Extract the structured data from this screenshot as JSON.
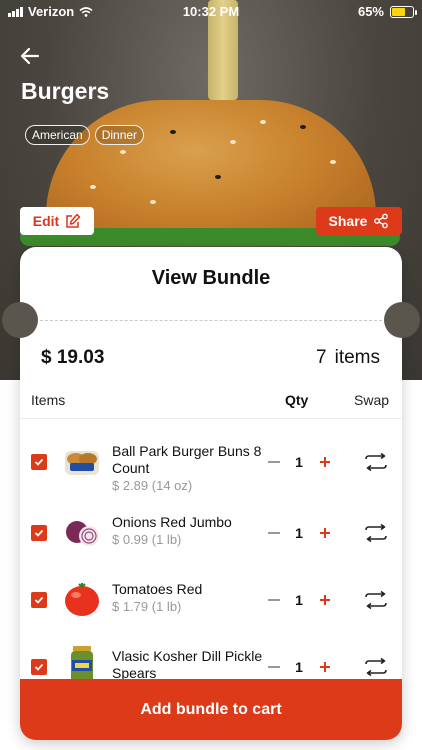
{
  "status_bar": {
    "carrier": "Verizon",
    "time": "10:32 PM",
    "battery": "65%"
  },
  "recipe": {
    "title": "Burgers",
    "tags": [
      "American",
      "Dinner"
    ]
  },
  "actions": {
    "edit_label": "Edit",
    "share_label": "Share"
  },
  "bundle": {
    "title": "View Bundle",
    "total": "$ 19.03",
    "item_count": "7",
    "items_word": "items",
    "headers": {
      "items": "Items",
      "qty": "Qty",
      "swap": "Swap"
    },
    "items": [
      {
        "name": "Ball Park Burger Buns 8 Count",
        "price": "$ 2.89 (14 oz)",
        "qty": "1",
        "checked": true,
        "icon": "buns-icon"
      },
      {
        "name": "Onions   Red   Jumbo",
        "price": "$ 0.99 (1 lb)",
        "qty": "1",
        "checked": true,
        "icon": "onion-icon"
      },
      {
        "name": "Tomatoes   Red",
        "price": "$ 1.79 (1 lb)",
        "qty": "1",
        "checked": true,
        "icon": "tomato-icon"
      },
      {
        "name": "Vlasic Kosher Dill Pickle Spears",
        "price": "",
        "qty": "1",
        "checked": true,
        "icon": "pickle-jar-icon"
      }
    ],
    "cta_label": "Add bundle to cart"
  },
  "colors": {
    "accent": "#dd3a1a",
    "battery": "#ffd60a"
  }
}
